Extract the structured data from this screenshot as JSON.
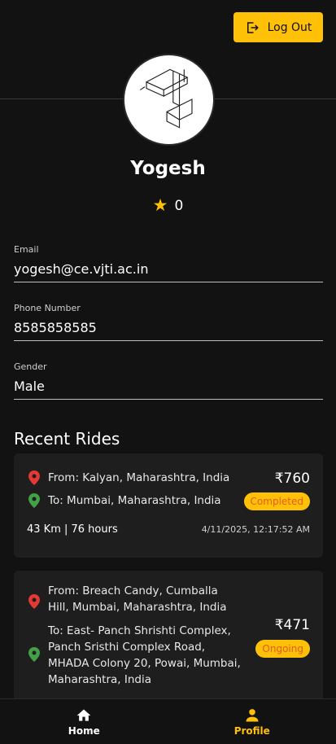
{
  "header": {
    "logout_label": "Log Out"
  },
  "profile": {
    "name": "Yogesh",
    "rating": "0"
  },
  "fields": {
    "email": {
      "label": "Email",
      "value": "yogesh@ce.vjti.ac.in"
    },
    "phone": {
      "label": "Phone Number",
      "value": "8585858585"
    },
    "gender": {
      "label": "Gender",
      "value": "Male"
    }
  },
  "recent_rides": {
    "title": "Recent Rides",
    "rides": [
      {
        "from": "From: Kalyan, Maharashtra, India",
        "to": "To: Mumbai, Maharashtra, India",
        "price": "₹760",
        "status": "Completed",
        "meta": "43 Km | 76 hours",
        "date": "4/11/2025, 12:17:52 AM"
      },
      {
        "from": "From: Breach Candy, Cumballa Hill, Mumbai, Maharashtra, India",
        "to": "To: East- Panch Shrishti Complex, Panch Sristhi Complex Road, MHADA Colony 20, Powai, Mumbai, Maharashtra, India",
        "price": "₹471",
        "status": "Ongoing"
      }
    ]
  },
  "bottom_nav": {
    "home_label": "Home",
    "profile_label": "Profile"
  },
  "colors": {
    "accent": "#FFC107",
    "background": "#121212",
    "card": "#1e1e1e",
    "pin_from": "#e53935",
    "pin_to": "#43a047"
  },
  "icons": {
    "logout": "logout-icon",
    "star": "star-icon",
    "pin_from": "location-pin-icon",
    "pin_to": "location-pin-icon",
    "home": "home-icon",
    "profile": "person-icon"
  }
}
